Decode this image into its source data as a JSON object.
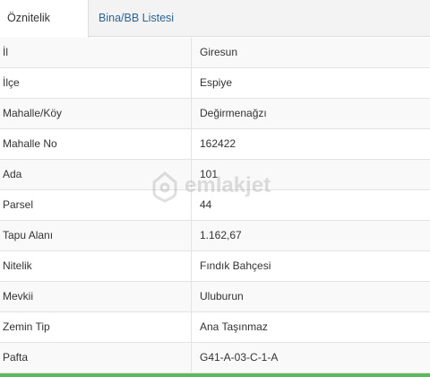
{
  "tabs": {
    "attributes_label": "Öznitelik Bilgisi",
    "building_list_label": "Bina/BB Listesi"
  },
  "rows": [
    {
      "key": "İl",
      "value": "Giresun"
    },
    {
      "key": "İlçe",
      "value": "Espiye"
    },
    {
      "key": "Mahalle/Köy",
      "value": "Değirmenağzı"
    },
    {
      "key": "Mahalle No",
      "value": "162422"
    },
    {
      "key": "Ada",
      "value": "101"
    },
    {
      "key": "Parsel",
      "value": "44"
    },
    {
      "key": "Tapu Alanı",
      "value": "1.162,67"
    },
    {
      "key": "Nitelik",
      "value": "Fındık Bahçesi"
    },
    {
      "key": "Mevkii",
      "value": "Uluburun"
    },
    {
      "key": "Zemin Tip",
      "value": "Ana Taşınmaz"
    },
    {
      "key": "Pafta",
      "value": "G41-A-03-C-1-A"
    }
  ],
  "watermark": {
    "text": "emlakjet",
    "icon": "house-pin-icon"
  },
  "colors": {
    "link": "#2a6496",
    "accent_green": "#5cb85c"
  }
}
